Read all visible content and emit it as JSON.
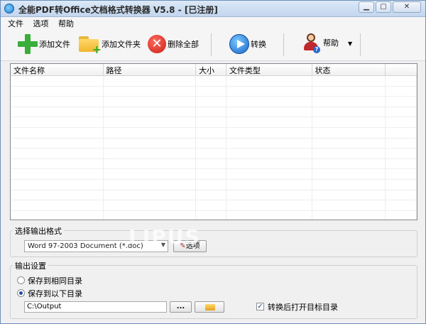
{
  "window": {
    "title": "全能PDF转Office文档格式转换器 V5.8  -  [已注册]",
    "min_label": "▁",
    "max_label": "▢",
    "close_label": "✕"
  },
  "menu": [
    {
      "label": "文件"
    },
    {
      "label": "选项"
    },
    {
      "label": "帮助"
    }
  ],
  "toolbar": {
    "add_file": "添加文件",
    "add_folder": "添加文件夹",
    "delete_all": "删除全部",
    "convert": "转换",
    "help": "帮助",
    "dropdown_arrow": "▼"
  },
  "filelist": {
    "columns": [
      "文件名称",
      "路径",
      "大小",
      "文件类型",
      "状态"
    ],
    "rows": []
  },
  "output_format": {
    "group_label": "选择输出格式",
    "selected": "Word 97-2003 Document (*.doc)",
    "options_button": "选项"
  },
  "output_settings": {
    "group_label": "输出设置",
    "radio_same": "保存到相同目录",
    "radio_custom": "保存到以下目录",
    "selected_radio": "custom",
    "path": "C:\\Output",
    "browse_button": "...",
    "open_after_label": "转换后打开目标目录",
    "open_after_checked": true
  },
  "watermark": "LIPUS"
}
